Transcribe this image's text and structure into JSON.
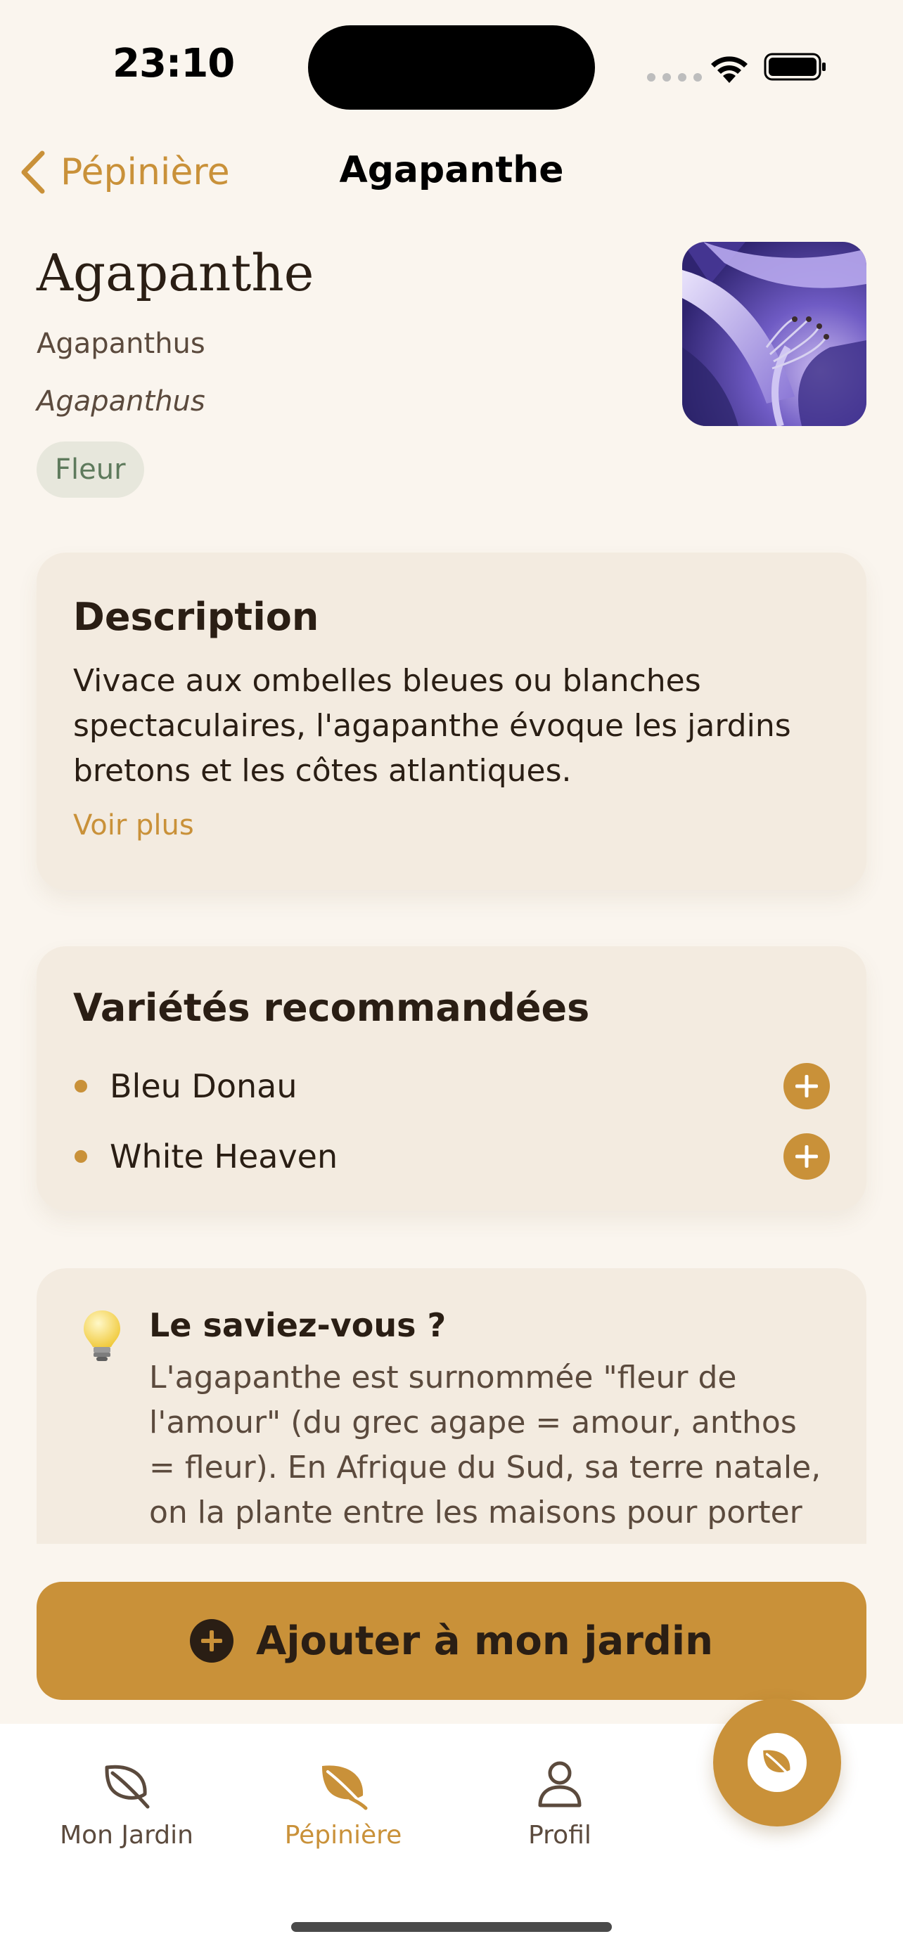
{
  "status_bar": {
    "time": "23:10"
  },
  "nav": {
    "back_label": "Pépinière",
    "title": "Agapanthe"
  },
  "plant": {
    "name": "Agapanthe",
    "common_name": "Agapanthus",
    "latin_name": "Agapanthus",
    "category": "Fleur"
  },
  "description": {
    "title": "Description",
    "text": "Vivace aux ombelles bleues ou blanches spectaculaires, l'agapanthe évoque les jardins bretons et les côtes atlantiques.",
    "more_label": "Voir plus"
  },
  "varieties": {
    "title": "Variétés recommandées",
    "items": [
      {
        "label": "Bleu Donau"
      },
      {
        "label": "White Heaven"
      }
    ]
  },
  "fact": {
    "title": "Le saviez-vous ?",
    "text": "L'agapanthe est surnommée \"fleur de l'amour\" (du grec agape = amour, anthos = fleur). En Afrique du Sud, sa terre natale, on la plante entre les maisons pour porter"
  },
  "cta": {
    "label": "Ajouter à mon jardin"
  },
  "tabs": [
    {
      "label": "Mon Jardin",
      "icon": "leaf-outline-icon",
      "active": false
    },
    {
      "label": "Pépinière",
      "icon": "leaf-filled-icon",
      "active": true
    },
    {
      "label": "Profil",
      "icon": "person-icon",
      "active": false
    }
  ],
  "colors": {
    "accent": "#c99139",
    "background": "#faf5ee",
    "card": "#f3ebe0",
    "text": "#2a1e14",
    "chip_bg": "#e7e7dc",
    "chip_text": "#5e7a5c"
  }
}
